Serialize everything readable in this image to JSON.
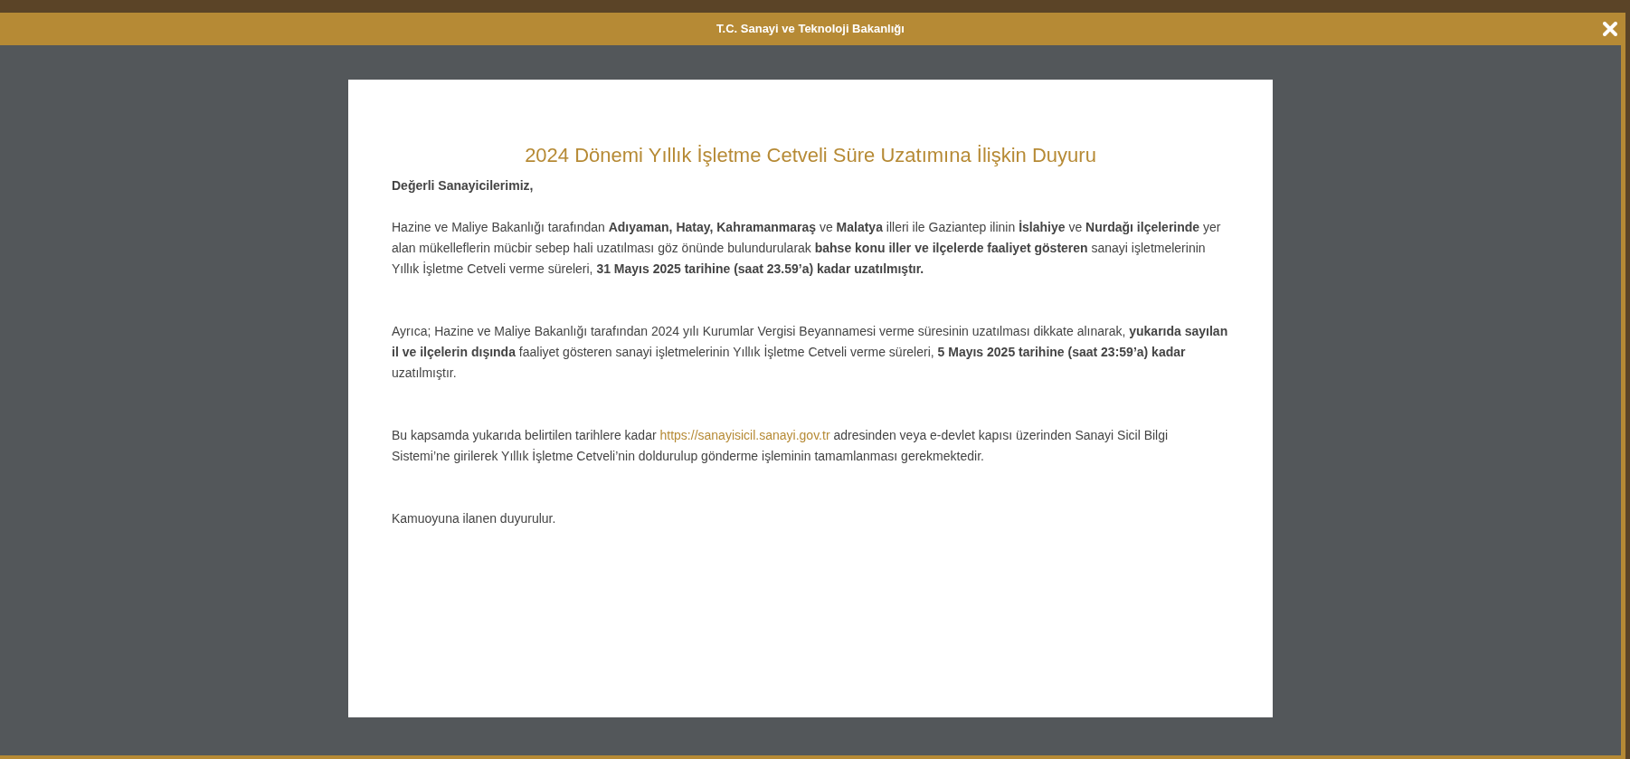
{
  "modal": {
    "title": "T.C. Sanayi ve Teknoloji Bakanlığı"
  },
  "announcement": {
    "heading": "2024 Dönemi Yıllık İşletme Cetveli Süre Uzatımına İlişkin Duyuru",
    "greeting": "Değerli Sanayicilerimiz,",
    "paragraphs": [
      {
        "text": "Hazine ve Maliye Bakanlığı tarafından **Adıyaman, Hatay, Kahramanmaraş** ve **Malatya** illeri ile Gaziantep ilinin **İslahiye** ve **Nurdağı ilçelerinde** yer alan mükelleflerin mücbir sebep hali uzatılması göz önünde bulundurularak **bahse konu iller ve ilçelerde faaliyet gösteren** sanayi işletmelerinin Yıllık İşletme Cetveli verme süreleri, **31 Mayıs 2025 tarihine (saat 23.59’a) kadar uzatılmıştır.**"
      },
      {
        "text": "Ayrıca; Hazine ve Maliye Bakanlığı tarafından 2024 yılı Kurumlar Vergisi Beyannamesi verme süresinin uzatılması dikkate alınarak, **yukarıda sayılan il ve ilçelerin dışında** faaliyet gösteren sanayi işletmelerinin Yıllık İşletme Cetveli verme süreleri, **5 Mayıs 2025 tarihine (saat 23:59’a) kadar** uzatılmıştır."
      },
      {
        "text": "Bu kapsamda yukarıda belirtilen tarihlere kadar",
        "link": "https://sanayisicil.sanayi.gov.tr",
        "text_after": "adresinden veya e-devlet kapısı üzerinden Sanayi Sicil Bilgi Sistemi’ne girilerek Yıllık İşletme Cetveli’nin doldurulup gönderme işleminin tamamlanması gerekmektedir."
      },
      {
        "text": "Kamuoyuna ilanen duyurulur."
      }
    ]
  }
}
